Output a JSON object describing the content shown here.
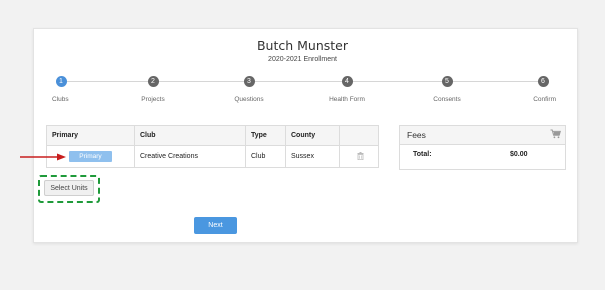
{
  "header": {
    "name": "Butch Munster",
    "subtitle": "2020-2021 Enrollment"
  },
  "steps": [
    {
      "number": "1",
      "label": "Clubs",
      "active": true
    },
    {
      "number": "2",
      "label": "Projects",
      "active": false
    },
    {
      "number": "3",
      "label": "Questions",
      "active": false
    },
    {
      "number": "4",
      "label": "Health Form",
      "active": false
    },
    {
      "number": "5",
      "label": "Consents",
      "active": false
    },
    {
      "number": "6",
      "label": "Confirm",
      "active": false
    }
  ],
  "table": {
    "headers": [
      "Primary",
      "Club",
      "Type",
      "County",
      ""
    ],
    "rows": [
      {
        "primary_label": "Primary",
        "club": "Creative Creations",
        "type": "Club",
        "county": "Sussex"
      }
    ]
  },
  "actions": {
    "select_units": "Select Units",
    "next": "Next"
  },
  "fees": {
    "title": "Fees",
    "total_label": "Total:",
    "total_value": "$0.00"
  },
  "icons": {
    "trash": "trash-icon",
    "cart": "cart-icon",
    "arrow": "arrow-annotation-icon"
  },
  "colors": {
    "accent": "#4a90d9",
    "primary_button": "#8fc0ee",
    "annotation_red": "#c81e1e",
    "annotation_green": "#1f9a3a"
  }
}
